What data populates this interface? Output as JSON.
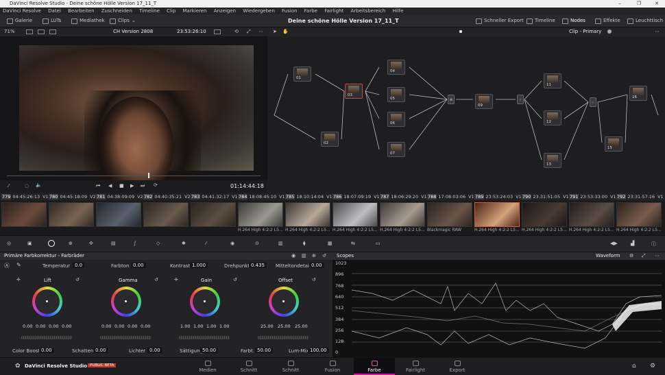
{
  "window": {
    "title": "DaVinci Resolve Studio - Deine schöne Hölle Version 17_11_T",
    "controls": [
      "–",
      "❐",
      "✕"
    ]
  },
  "menu": [
    "DaVinci Resolve",
    "Datei",
    "Bearbeiten",
    "Zuschneiden",
    "Timeline",
    "Clip",
    "Markieren",
    "Anzeigen",
    "Wiedergeben",
    "Fusion",
    "Farbe",
    "Fairlight",
    "Arbeitsbereich",
    "Hilfe"
  ],
  "toolbar": {
    "gallery": "Galerie",
    "luts": "LUTs",
    "media": "Mediathek",
    "clips": "Clips",
    "project": "Deine schöne Hölle Version 17_11_T",
    "quick_export": "Schneller Export",
    "timeline": "Timeline",
    "nodes": "Nodes",
    "effects": "Effekte",
    "light": "Leuchttisch"
  },
  "viewer": {
    "zoom": "71%",
    "timeline_name": "CH Version 2808",
    "timecode": "23:53:26:10",
    "playhead_tc": "01:14:44:18"
  },
  "nodebar": {
    "mode": "Clip - Primary"
  },
  "nodes": [
    {
      "id": "01",
      "label": "01"
    },
    {
      "id": "02",
      "label": "02"
    },
    {
      "id": "03",
      "label": "03"
    },
    {
      "id": "04",
      "label": "04"
    },
    {
      "id": "05",
      "label": "05"
    },
    {
      "id": "06",
      "label": "06"
    },
    {
      "id": "07",
      "label": "07"
    },
    {
      "id": "09",
      "label": "09"
    },
    {
      "id": "11",
      "label": "11"
    },
    {
      "id": "12",
      "label": "12"
    },
    {
      "id": "13",
      "label": "13"
    },
    {
      "id": "15",
      "label": "15"
    },
    {
      "id": "16",
      "label": "16"
    }
  ],
  "clips": [
    {
      "num": "779",
      "tc": "04:45:26:13",
      "track": "V1",
      "label": ""
    },
    {
      "num": "780",
      "tc": "04:45:18:09",
      "track": "V2",
      "label": ""
    },
    {
      "num": "781",
      "tc": "04:38:09:09",
      "track": "V2",
      "label": ""
    },
    {
      "num": "782",
      "tc": "04:40:35:21",
      "track": "V2",
      "label": ""
    },
    {
      "num": "783",
      "tc": "04:41:32:17",
      "track": "V1",
      "label": ""
    },
    {
      "num": "784",
      "tc": "18:08:45:10",
      "track": "V1",
      "label": "H.264 High 4:2:2 L5..."
    },
    {
      "num": "785",
      "tc": "18:10:14:04",
      "track": "V1",
      "label": "H.264 High 4:2:2 L5..."
    },
    {
      "num": "786",
      "tc": "18:07:09:19",
      "track": "V1",
      "label": "H.264 High 4:2:2 L5..."
    },
    {
      "num": "787",
      "tc": "18:06:29:20",
      "track": "V1",
      "label": "H.264 High 4:2:2 L5..."
    },
    {
      "num": "788",
      "tc": "17:08:03:06",
      "track": "V1",
      "label": "Blackmagic RAW"
    },
    {
      "num": "789",
      "tc": "23:53:24:03",
      "track": "V1",
      "label": "H.264 High 4:2:2 L5..."
    },
    {
      "num": "790",
      "tc": "23:31:51:05",
      "track": "V1",
      "label": "H.264 High 4:2:2 L5..."
    },
    {
      "num": "791",
      "tc": "23:53:33:00",
      "track": "V1",
      "label": "H.264 High 4:2:2 L5..."
    },
    {
      "num": "792",
      "tc": "23:31:57:16",
      "track": "V1",
      "label": "H.264 High 4:2:2 L5..."
    }
  ],
  "panel": {
    "title": "Primäre Farbkorrektur - Farbräder",
    "temp_label": "Temperatur",
    "temp": "0.0",
    "tint_label": "Farbton",
    "tint": "0.00",
    "contrast_label": "Kontrast",
    "contrast": "1.000",
    "pivot_label": "Drehpunkt",
    "pivot": "0.435",
    "mid_label": "Mitteltondetail",
    "mid": "0.00"
  },
  "wheels": [
    {
      "name": "Lift",
      "vals": [
        "0.00",
        "0.00",
        "0.00",
        "0.00"
      ]
    },
    {
      "name": "Gamma",
      "vals": [
        "0.00",
        "0.00",
        "0.00",
        "0.00"
      ]
    },
    {
      "name": "Gain",
      "vals": [
        "1.00",
        "1.00",
        "1.00",
        "1.00"
      ]
    },
    {
      "name": "Offset",
      "vals": [
        "25.00",
        "25.00",
        "25.00"
      ]
    }
  ],
  "bottomparams": {
    "boost_label": "Color Boost",
    "boost": "0.00",
    "shadows_label": "Schatten",
    "shadows": "0.00",
    "highlights_label": "Lichter",
    "highlights": "0.00",
    "sat_label": "Sättigung",
    "sat": "50.00",
    "hue_label": "Farbt.",
    "hue": "50.00",
    "lummix_label": "Lum-Mix",
    "lummix": "100.00"
  },
  "scopes": {
    "title": "Scopes",
    "type": "Waveform",
    "ticks": [
      "1023",
      "896",
      "768",
      "640",
      "512",
      "384",
      "256",
      "128",
      "0"
    ]
  },
  "app": {
    "name": "DaVinci Resolve Studio 19",
    "beta": "PUBLIC BETA"
  },
  "pages": [
    "Medien",
    "Schnitt",
    "Schnitt",
    "Fusion",
    "Farbe",
    "Fairlight",
    "Export"
  ]
}
